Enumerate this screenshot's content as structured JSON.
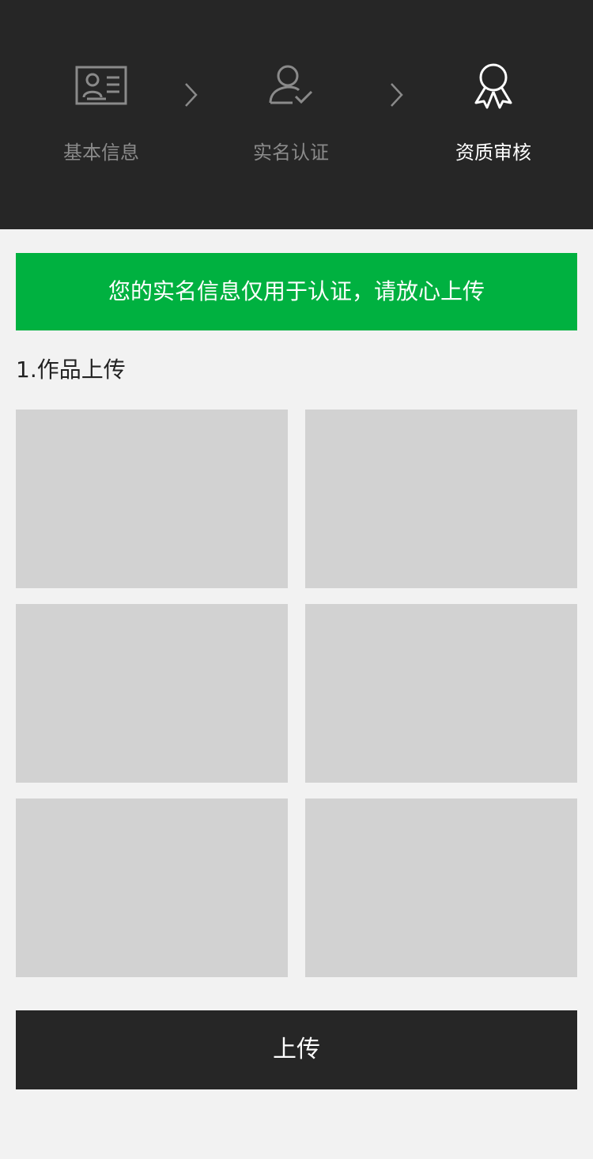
{
  "steps": [
    {
      "label": "基本信息",
      "icon": "id-card-icon",
      "state": "inactive"
    },
    {
      "label": "实名认证",
      "icon": "user-check-icon",
      "state": "inactive"
    },
    {
      "label": "资质审核",
      "icon": "award-ribbon-icon",
      "state": "active"
    }
  ],
  "notice": {
    "text": "您的实名信息仅用于认证，请放心上传",
    "color": "#00b140"
  },
  "works": {
    "title": "1.作品上传",
    "slot_count": 6
  },
  "upload_button": {
    "label": "上传"
  },
  "colors": {
    "header_bg": "#262626",
    "page_bg": "#f2f2f2",
    "inactive_text": "#8a8a8a",
    "active_text": "#ffffff",
    "slot_bg": "#d2d2d2"
  }
}
